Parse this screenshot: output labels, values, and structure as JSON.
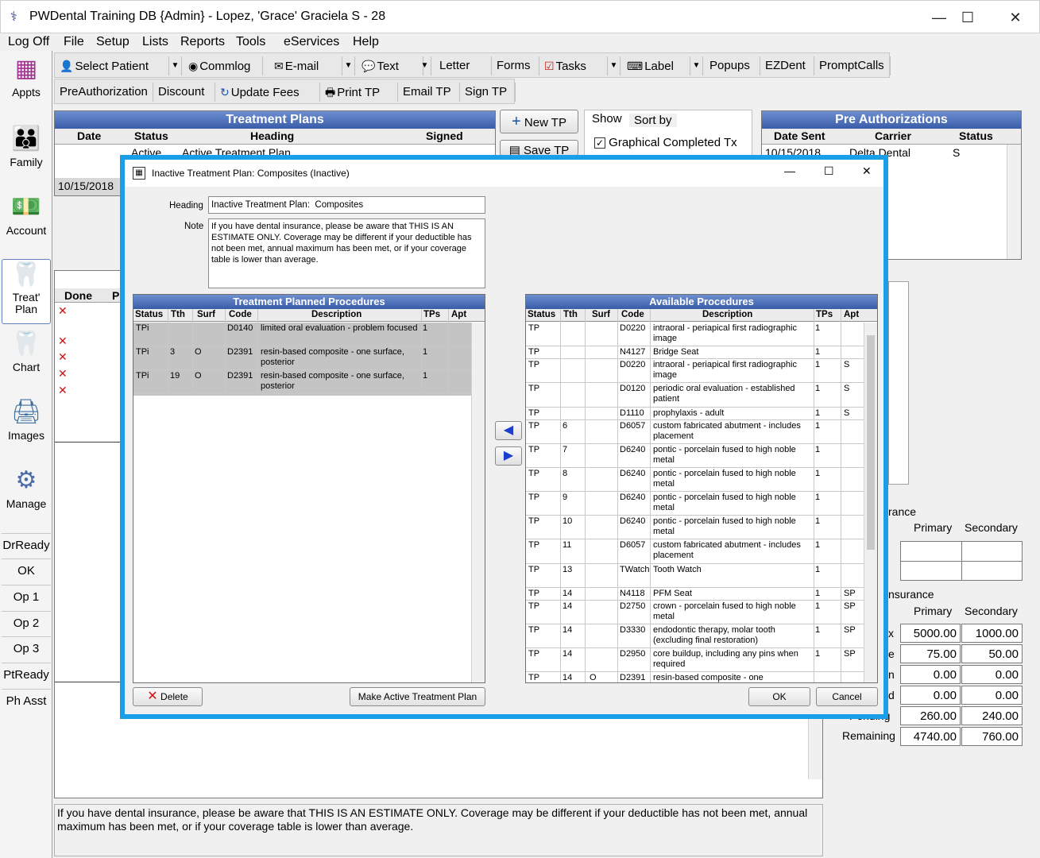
{
  "window": {
    "title": "PWDental Training DB {Admin} - Lopez, 'Grace' Graciela S - 28",
    "minimize": "—",
    "maximize": "☐",
    "close": "✕"
  },
  "menu": [
    "Log Off",
    "File",
    "Setup",
    "Lists",
    "Reports",
    "Tools",
    "eServices",
    "Help"
  ],
  "outlook": {
    "items": [
      {
        "label": "Appts",
        "icon": "calendar-icon"
      },
      {
        "label": "Family",
        "icon": "family-icon"
      },
      {
        "label": "Account",
        "icon": "money-icon"
      },
      {
        "label": "Treat' Plan",
        "icon": "tooth-plan-icon"
      },
      {
        "label": "Chart",
        "icon": "tooth-icon"
      },
      {
        "label": "Images",
        "icon": "scanner-icon"
      },
      {
        "label": "Manage",
        "icon": "gears-icon"
      }
    ],
    "buttons": [
      "DrReady",
      "OK",
      "Op 1",
      "Op 2",
      "Op 3",
      "PtReady",
      "Ph Asst"
    ]
  },
  "toolbar1": [
    "Select Patient",
    "Commlog",
    "E-mail",
    "Text",
    "Letter",
    "Forms",
    "Tasks",
    "Label",
    "Popups",
    "EZDent",
    "PromptCalls"
  ],
  "toolbar2": [
    "PreAuthorization",
    "Discount",
    "Update Fees",
    "Print TP",
    "Email TP",
    "Sign TP"
  ],
  "treatmentPlans": {
    "title": "Treatment Plans",
    "headers": [
      "Date",
      "Status",
      "Heading",
      "Signed"
    ],
    "row1": {
      "date": "",
      "status": "Active",
      "heading": "Active Treatment Plan"
    },
    "row2": {
      "date": "10/15/2018"
    }
  },
  "tpButtons": {
    "new": "New TP",
    "save": "Save TP"
  },
  "showTabs": {
    "show": "Show",
    "sortby": "Sort by",
    "graphical": "Graphical Completed Tx"
  },
  "preAuth": {
    "title": "Pre Authorizations",
    "headers": [
      "Date Sent",
      "Carrier",
      "Status"
    ],
    "row": {
      "date": "10/15/2018",
      "carrier": "Delta Dental",
      "status": "S"
    }
  },
  "procGrid": {
    "headers": [
      "Done",
      "P"
    ]
  },
  "insurance": {
    "group1": "rance",
    "primary": "Primary",
    "secondary": "Secondary",
    "group2": "nsurance",
    "rows": [
      {
        "label": "x",
        "primary": "5000.00",
        "secondary": "1000.00"
      },
      {
        "label": "e",
        "primary": "75.00",
        "secondary": "50.00"
      },
      {
        "label": "n",
        "primary": "0.00",
        "secondary": "0.00"
      },
      {
        "label": "d",
        "primary": "0.00",
        "secondary": "0.00"
      },
      {
        "label": "Pending",
        "primary": "260.00",
        "secondary": "240.00"
      },
      {
        "label": "Remaining",
        "primary": "4740.00",
        "secondary": "760.00"
      }
    ]
  },
  "bottomNote": "If you have dental insurance, please be aware that THIS IS AN ESTIMATE ONLY.  Coverage may be different if your deductible has not been met, annual maximum has been met, or if your coverage table is lower than average.",
  "dialog": {
    "title": "Inactive Treatment Plan:  Composites    (Inactive)",
    "headingLabel": "Heading",
    "headingValue": "Inactive Treatment Plan:  Composites",
    "noteLabel": "Note",
    "noteValue": "If you have dental insurance, please be aware that THIS IS AN ESTIMATE ONLY.  Coverage may be different if your deductible has not been met, annual maximum has been met, or if your coverage table is lower than average.",
    "planned": {
      "title": "Treatment Planned Procedures",
      "headers": [
        "Status",
        "Tth",
        "Surf",
        "Code",
        "Description",
        "TPs",
        "Apt"
      ],
      "rows": [
        {
          "status": "TPi",
          "tth": "",
          "surf": "",
          "code": "D0140",
          "desc": "limited oral evaluation - problem focused",
          "tps": "1",
          "apt": ""
        },
        {
          "status": "TPi",
          "tth": "3",
          "surf": "O",
          "code": "D2391",
          "desc": "resin-based composite - one surface, posterior",
          "tps": "1",
          "apt": ""
        },
        {
          "status": "TPi",
          "tth": "19",
          "surf": "O",
          "code": "D2391",
          "desc": "resin-based composite - one surface, posterior",
          "tps": "1",
          "apt": ""
        }
      ]
    },
    "available": {
      "title": "Available Procedures",
      "headers": [
        "Status",
        "Tth",
        "Surf",
        "Code",
        "Description",
        "TPs",
        "Apt"
      ],
      "rows": [
        {
          "status": "TP",
          "tth": "",
          "surf": "",
          "code": "D0220",
          "desc": "intraoral - periapical first radiographic image",
          "tps": "1",
          "apt": "",
          "h": 30
        },
        {
          "status": "TP",
          "tth": "",
          "surf": "",
          "code": "N4127",
          "desc": "Bridge Seat",
          "tps": "1",
          "apt": "",
          "h": 16
        },
        {
          "status": "TP",
          "tth": "",
          "surf": "",
          "code": "D0220",
          "desc": "intraoral - periapical first radiographic image",
          "tps": "1",
          "apt": "S",
          "h": 30
        },
        {
          "status": "TP",
          "tth": "",
          "surf": "",
          "code": "D0120",
          "desc": "periodic oral evaluation - established patient",
          "tps": "1",
          "apt": "S",
          "h": 31
        },
        {
          "status": "TP",
          "tth": "",
          "surf": "",
          "code": "D1110",
          "desc": "prophylaxis - adult",
          "tps": "1",
          "apt": "S",
          "h": 16
        },
        {
          "status": "TP",
          "tth": "6",
          "surf": "",
          "code": "D6057",
          "desc": "custom fabricated abutment - includes placement",
          "tps": "1",
          "apt": "",
          "h": 30
        },
        {
          "status": "TP",
          "tth": "7",
          "surf": "",
          "code": "D6240",
          "desc": "pontic - porcelain fused to high noble metal",
          "tps": "1",
          "apt": "",
          "h": 30
        },
        {
          "status": "TP",
          "tth": "8",
          "surf": "",
          "code": "D6240",
          "desc": "pontic - porcelain fused to high noble metal",
          "tps": "1",
          "apt": "",
          "h": 30
        },
        {
          "status": "TP",
          "tth": "9",
          "surf": "",
          "code": "D6240",
          "desc": "pontic - porcelain fused to high noble metal",
          "tps": "1",
          "apt": "",
          "h": 30
        },
        {
          "status": "TP",
          "tth": "10",
          "surf": "",
          "code": "D6240",
          "desc": "pontic - porcelain fused to high noble metal",
          "tps": "1",
          "apt": "",
          "h": 30
        },
        {
          "status": "TP",
          "tth": "11",
          "surf": "",
          "code": "D6057",
          "desc": "custom fabricated abutment - includes placement",
          "tps": "1",
          "apt": "",
          "h": 31
        },
        {
          "status": "TP",
          "tth": "13",
          "surf": "",
          "code": "TWatch",
          "desc": "Tooth Watch",
          "tps": "1",
          "apt": "",
          "h": 30
        },
        {
          "status": "TP",
          "tth": "14",
          "surf": "",
          "code": "N4118",
          "desc": "PFM Seat",
          "tps": "1",
          "apt": "SP",
          "h": 16
        },
        {
          "status": "TP",
          "tth": "14",
          "surf": "",
          "code": "D2750",
          "desc": "crown - porcelain fused to high noble metal",
          "tps": "1",
          "apt": "SP",
          "h": 30
        },
        {
          "status": "TP",
          "tth": "14",
          "surf": "",
          "code": "D3330",
          "desc": "endodontic therapy, molar tooth (excluding final restoration)",
          "tps": "1",
          "apt": "SP",
          "h": 30
        },
        {
          "status": "TP",
          "tth": "14",
          "surf": "",
          "code": "D2950",
          "desc": "core buildup, including any pins when required",
          "tps": "1",
          "apt": "SP",
          "h": 30
        },
        {
          "status": "TP",
          "tth": "14",
          "surf": "O",
          "code": "D2391",
          "desc": "resin-based composite - one",
          "tps": "",
          "apt": "",
          "h": 16
        }
      ]
    },
    "buttons": {
      "delete": "Delete",
      "makeActive": "Make Active Treatment Plan",
      "ok": "OK",
      "cancel": "Cancel"
    }
  }
}
